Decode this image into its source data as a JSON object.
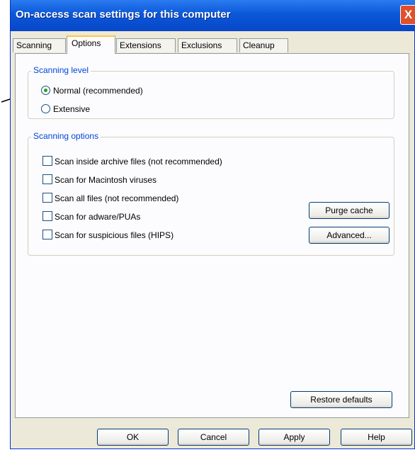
{
  "window": {
    "title": "On-access scan settings for this computer",
    "close_glyph": "X"
  },
  "tabs": [
    {
      "label": "Scanning",
      "active": false
    },
    {
      "label": "Options",
      "active": true
    },
    {
      "label": "Extensions",
      "active": false
    },
    {
      "label": "Exclusions",
      "active": false
    },
    {
      "label": "Cleanup",
      "active": false
    }
  ],
  "scanning_level": {
    "legend": "Scanning level",
    "options": [
      {
        "label": "Normal (recommended)",
        "selected": true
      },
      {
        "label": "Extensive",
        "selected": false
      }
    ]
  },
  "scanning_options": {
    "legend": "Scanning options",
    "checkboxes": [
      {
        "label": "Scan inside archive files (not recommended)",
        "checked": false
      },
      {
        "label": "Scan for Macintosh viruses",
        "checked": false
      },
      {
        "label": "Scan all files (not recommended)",
        "checked": false
      },
      {
        "label": "Scan for adware/PUAs",
        "checked": false
      },
      {
        "label": "Scan for suspicious files (HIPS)",
        "checked": false
      }
    ],
    "purge_cache_label": "Purge cache",
    "advanced_label": "Advanced..."
  },
  "restore_defaults_label": "Restore defaults",
  "footer": {
    "ok": "OK",
    "cancel": "Cancel",
    "apply": "Apply",
    "help": "Help"
  },
  "colors": {
    "titlebar": "#0a58d8",
    "legend": "#0046d5",
    "dialog_bg": "#ece9d8",
    "active_tab_highlight": "#ffc83c"
  }
}
